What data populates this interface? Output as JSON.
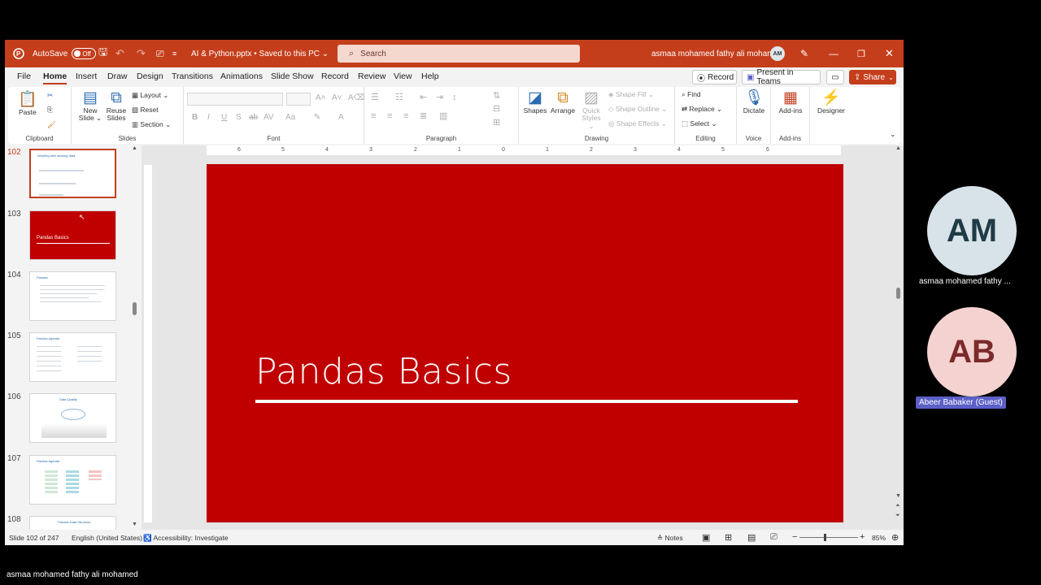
{
  "titlebar": {
    "autosave_label": "AutoSave",
    "autosave_state": "Off",
    "doc_title": "AI & Python.pptx • Saved to this PC ⌄",
    "search_placeholder": "Search",
    "user_name": "asmaa mohamed fathy ali mohamed",
    "user_initials": "AM"
  },
  "menu": {
    "tabs": [
      "File",
      "Home",
      "Insert",
      "Draw",
      "Design",
      "Transitions",
      "Animations",
      "Slide Show",
      "Record",
      "Review",
      "View",
      "Help"
    ],
    "active_tab": "Home",
    "record_label": "Record",
    "present_label": "Present in Teams",
    "share_label": "Share"
  },
  "ribbon": {
    "clipboard": {
      "paste": "Paste",
      "label": "Clipboard"
    },
    "slides": {
      "new_slide": "New Slide ⌄",
      "reuse_slides": "Reuse Slides",
      "layout": "Layout ⌄",
      "reset": "Reset",
      "section": "Section ⌄",
      "label": "Slides"
    },
    "font": {
      "label": "Font"
    },
    "paragraph": {
      "label": "Paragraph"
    },
    "drawing": {
      "shapes": "Shapes",
      "arrange": "Arrange",
      "quick_styles": "Quick Styles ⌄",
      "shape_fill": "Shape Fill ⌄",
      "shape_outline": "Shape Outline ⌄",
      "shape_effects": "Shape Effects ⌄",
      "label": "Drawing"
    },
    "editing": {
      "find": "Find",
      "replace": "Replace ⌄",
      "select": "Select ⌄",
      "label": "Editing"
    },
    "voice": {
      "dictate": "Dictate",
      "label": "Voice"
    },
    "addins": {
      "addins": "Add-ins",
      "label": "Add-ins"
    },
    "designer": {
      "designer": "Designer"
    }
  },
  "thumbnails": [
    {
      "number": "102",
      "title": "Working with missing data",
      "selected": true
    },
    {
      "number": "103",
      "title": "Pandas Basics",
      "selected": false
    },
    {
      "number": "104",
      "title": "Pandas",
      "selected": false
    },
    {
      "number": "105",
      "title": "Pandas Agenda",
      "selected": false
    },
    {
      "number": "106",
      "title": "Data Quality",
      "selected": false
    },
    {
      "number": "107",
      "title": "Pandas Agenda",
      "selected": false
    },
    {
      "number": "108",
      "title": "Pandas Data Structure",
      "selected": false
    }
  ],
  "slide": {
    "title": "Pandas Basics"
  },
  "ruler": {
    "h_ticks": [
      "6",
      "5",
      "4",
      "3",
      "2",
      "1",
      "0",
      "1",
      "2",
      "3",
      "4",
      "5",
      "6"
    ]
  },
  "status": {
    "slide_count": "Slide 102 of 247",
    "language": "English (United States)",
    "accessibility": "Accessibility: Investigate",
    "notes": "Notes",
    "zoom": "85%"
  },
  "participants": [
    {
      "initials": "AM",
      "name": "asmaa mohamed fathy ...",
      "bg": "#d7e3e8",
      "fg": "#1f3b45"
    },
    {
      "initials": "AB",
      "name": "Abeer Babaker (Guest)",
      "bg": "#f3d2d0",
      "fg": "#7b2a2a"
    }
  ],
  "presenter_name": "asmaa mohamed fathy ali mohamed",
  "colors": {
    "accent": "#c43e1c",
    "slide_bg": "#c00000"
  }
}
